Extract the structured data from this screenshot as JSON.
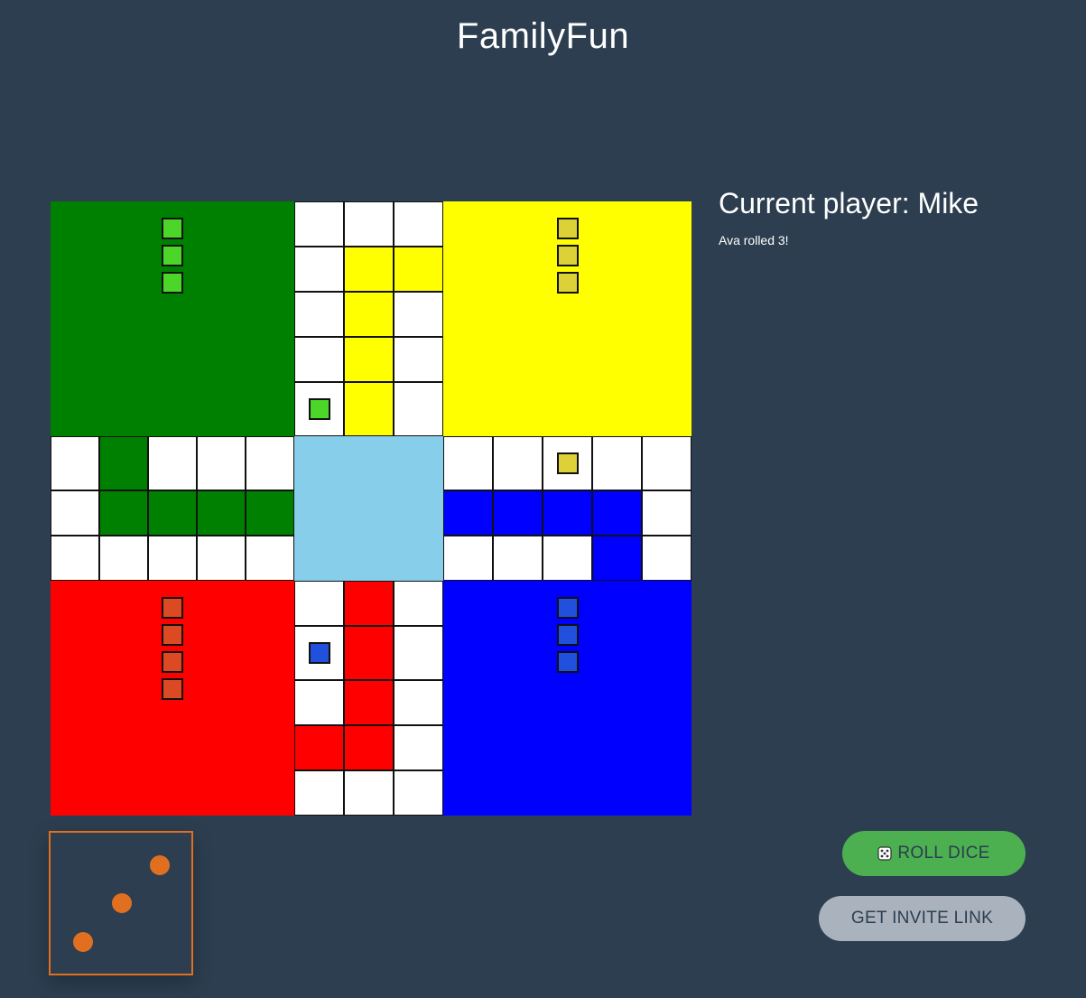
{
  "app": {
    "title": "FamilyFun"
  },
  "status": {
    "current_player": "Current player: Mike",
    "message": "Ava rolled 3!"
  },
  "buttons": {
    "roll_dice": "ROLL DICE",
    "get_invite_link": "GET INVITE LINK"
  },
  "dice": {
    "value": 3
  },
  "colors": {
    "green_home": "#008000",
    "yellow_home": "#ffff00",
    "red_home": "#ff0000",
    "blue_home": "#0000ff",
    "center": "#87ceeb",
    "cell": "#ffffff",
    "green_token": "#4cd62a",
    "yellow_token": "#dcd137",
    "red_token": "#dc4a23",
    "blue_token": "#2150dc",
    "dice_pip": "#e07020",
    "roll_button": "#4caf50",
    "invite_button": "#aab2bd"
  },
  "board": {
    "home_tokens": {
      "green": 3,
      "yellow": 3,
      "red": 4,
      "blue": 3
    },
    "track_tokens": [
      {
        "color": "green",
        "lane": "top-arm",
        "row": 4,
        "col": 0
      },
      {
        "color": "yellow",
        "lane": "right-arm",
        "row": 0,
        "col": 2
      },
      {
        "color": "blue",
        "lane": "bottom-arm",
        "row": 1,
        "col": 0
      }
    ]
  }
}
